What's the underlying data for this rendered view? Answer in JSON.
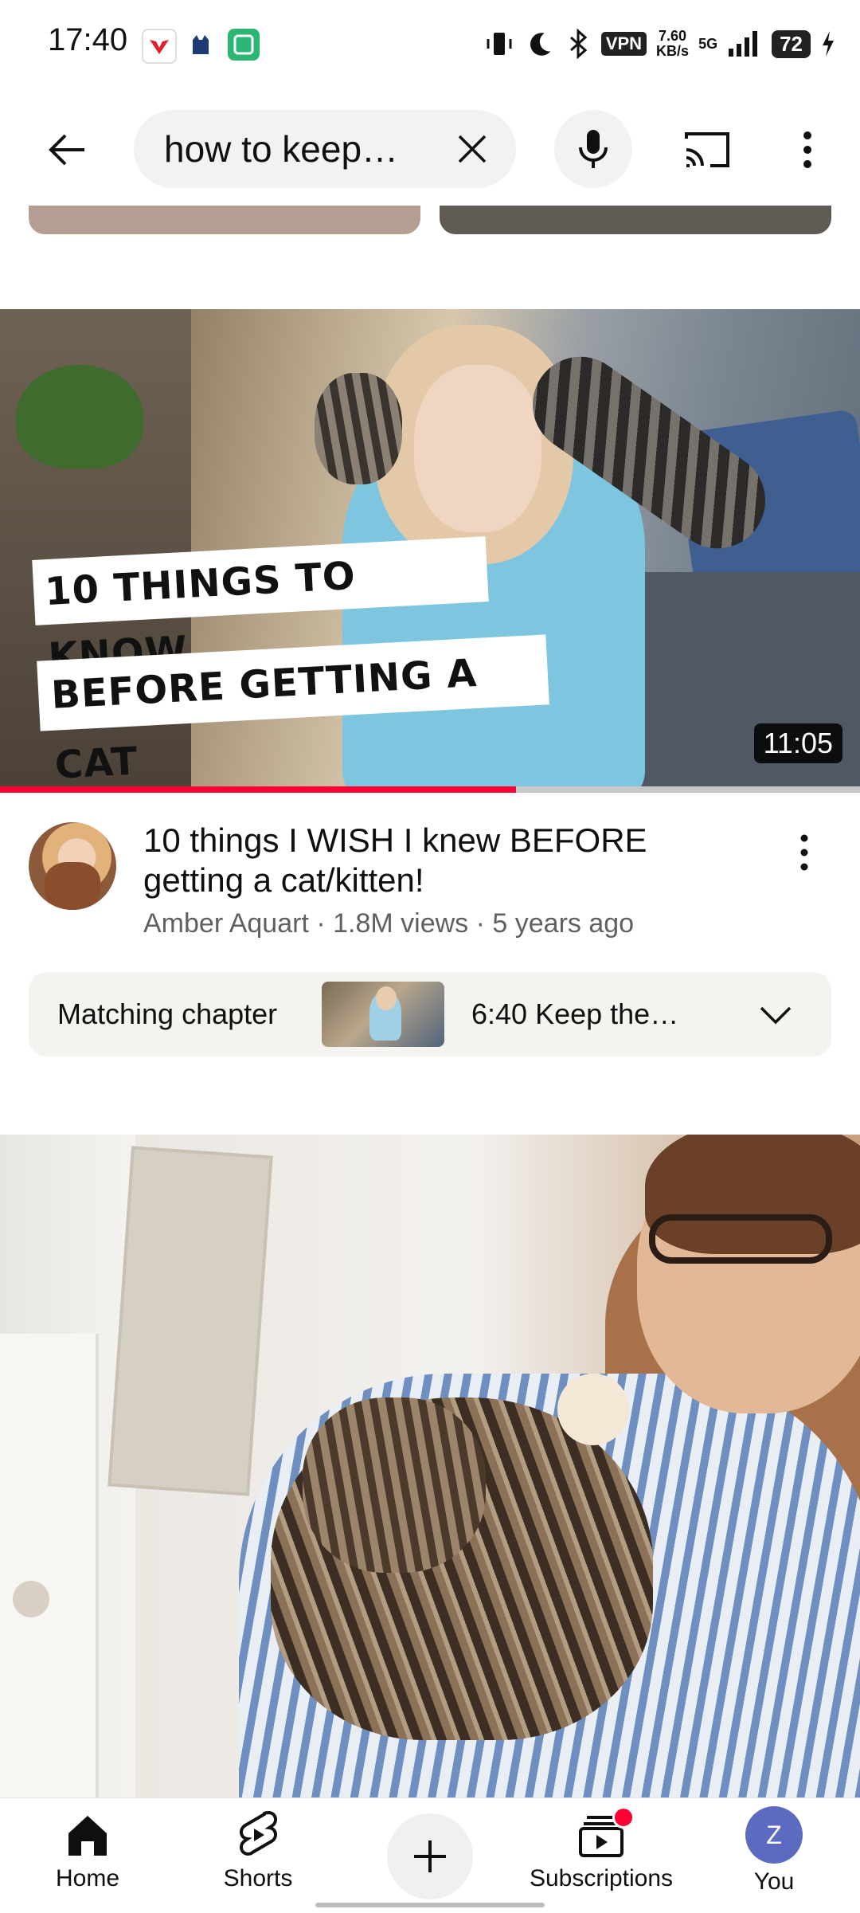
{
  "status_bar": {
    "time": "17:40",
    "vpn": "VPN",
    "speed_value": "7.60",
    "speed_unit": "KB/s",
    "network": "5G",
    "battery": "72"
  },
  "top_bar": {
    "search_query": "how to keep…",
    "icons": [
      "back-arrow-icon",
      "clear-icon",
      "mic-icon",
      "cast-icon",
      "more-vertical-icon"
    ]
  },
  "video1": {
    "thumbnail_text_line1": "10 THINGS TO KNOW",
    "thumbnail_text_line2": "BEFORE GETTING A CAT",
    "duration": "11:05",
    "watch_progress": 0.6,
    "title": "10 things I WISH I knew BEFORE getting a cat/kitten!",
    "channel": "Amber Aquart",
    "views": "1.8M views",
    "age": "5 years ago",
    "separator": " · "
  },
  "chapter": {
    "label": "Matching chapter",
    "text": "6:40 Keep the…"
  },
  "bottom_nav": {
    "home": "Home",
    "shorts": "Shorts",
    "subscriptions": "Subscriptions",
    "you": "You",
    "you_initial": "Z"
  },
  "colors": {
    "brand_red": "#ff0033",
    "you_avatar": "#5c6bc0"
  }
}
